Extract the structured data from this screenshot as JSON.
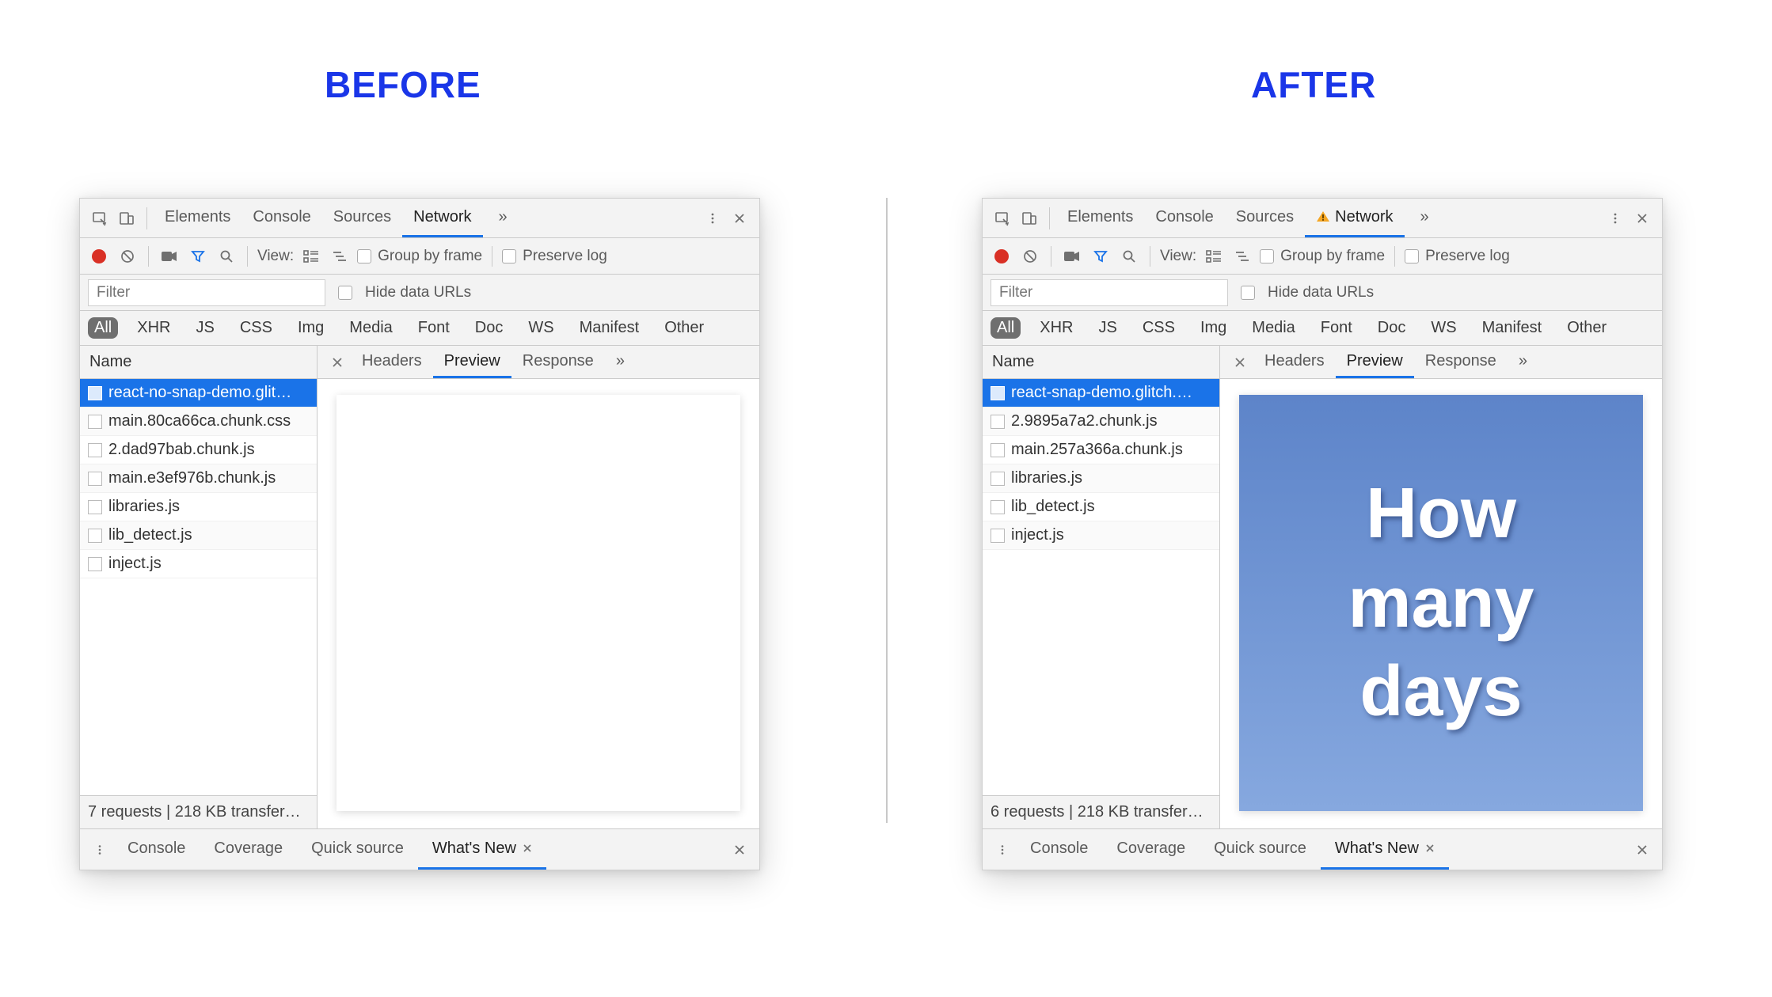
{
  "headings": {
    "before": "BEFORE",
    "after": "AFTER"
  },
  "top_tabs": [
    "Elements",
    "Console",
    "Sources",
    "Network"
  ],
  "top_tabs_overflow": "»",
  "toolbar": {
    "view_label": "View:",
    "group_label": "Group by frame",
    "preserve_label": "Preserve log"
  },
  "filterbar": {
    "placeholder": "Filter",
    "hide_label": "Hide data URLs"
  },
  "type_filters": [
    "All",
    "XHR",
    "JS",
    "CSS",
    "Img",
    "Media",
    "Font",
    "Doc",
    "WS",
    "Manifest",
    "Other"
  ],
  "columns": {
    "name": "Name"
  },
  "detail_tabs": [
    "Headers",
    "Preview",
    "Response"
  ],
  "detail_tabs_overflow": "»",
  "drawer_tabs": [
    "Console",
    "Coverage",
    "Quick source",
    "What's New"
  ],
  "before": {
    "requests": [
      "react-no-snap-demo.glit…",
      "main.80ca66ca.chunk.css",
      "2.dad97bab.chunk.js",
      "main.e3ef976b.chunk.js",
      "libraries.js",
      "lib_detect.js",
      "inject.js"
    ],
    "stats": "7 requests | 218 KB transfer…",
    "network_has_warning": false,
    "preview_lines": []
  },
  "after": {
    "requests": [
      "react-snap-demo.glitch.…",
      "2.9895a7a2.chunk.js",
      "main.257a366a.chunk.js",
      "libraries.js",
      "lib_detect.js",
      "inject.js"
    ],
    "stats": "6 requests | 218 KB transfer…",
    "network_has_warning": true,
    "preview_lines": [
      "How",
      "many",
      "days"
    ]
  }
}
